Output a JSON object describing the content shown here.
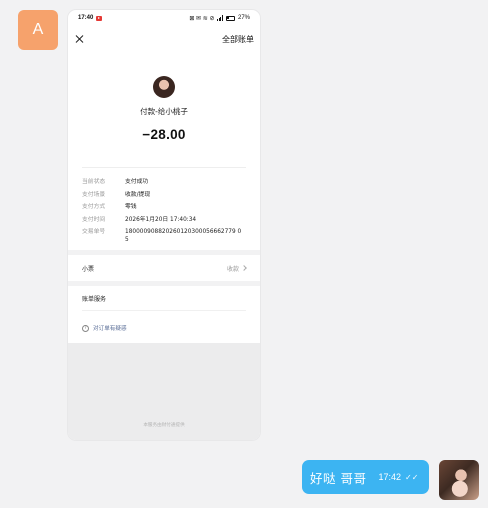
{
  "chat": {
    "contact_avatar_letter": "A",
    "message": {
      "text": "好哒  哥哥",
      "time": "17:42",
      "read_mark": "✓✓"
    }
  },
  "screenshot": {
    "statusbar": {
      "time": "17:40",
      "battery": "27%",
      "status_icons_text": "⊠ ✉ ≋ ⊘"
    },
    "navbar": {
      "close_icon": "close-icon",
      "all_bills": "全部账单"
    },
    "payee": "付款-给小桃子",
    "amount": "−28.00",
    "details": [
      {
        "label": "当前状态",
        "value": "支付成功"
      },
      {
        "label": "支付场景",
        "value": "收款/提现"
      },
      {
        "label": "支付方式",
        "value": "零钱"
      },
      {
        "label": "支付时间",
        "value": "2026年1月20日 17:40:34"
      },
      {
        "label": "交易单号",
        "value": "180000908820260120300056662779 05"
      }
    ],
    "note_row": {
      "label": "小票",
      "right": "收款"
    },
    "service": {
      "title": "账单服务",
      "question": "对订单有疑惑"
    },
    "footer_note": "本服务由财付通提供"
  }
}
